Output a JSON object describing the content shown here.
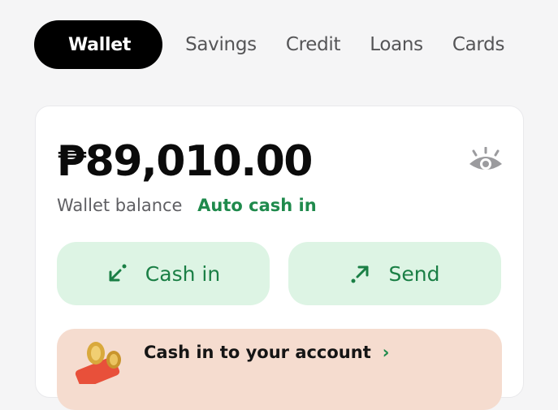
{
  "tabs": [
    {
      "label": "Wallet",
      "active": true
    },
    {
      "label": "Savings"
    },
    {
      "label": "Credit"
    },
    {
      "label": "Loans"
    },
    {
      "label": "Cards"
    }
  ],
  "wallet": {
    "balance": "₱89,010.00",
    "balance_label": "Wallet balance",
    "auto_cash_in": "Auto cash in",
    "visibility_icon": "eye-icon"
  },
  "actions": {
    "cash_in": {
      "label": "Cash in",
      "icon": "arrow-down-left-icon"
    },
    "send": {
      "label": "Send",
      "icon": "arrow-up-right-icon"
    }
  },
  "promo": {
    "text": "Cash in to your account",
    "chevron": "›"
  },
  "colors": {
    "accent_green": "#1f8a4c",
    "action_bg": "#ddf4e4",
    "promo_bg": "#f5dccf",
    "active_tab_bg": "#000000"
  }
}
